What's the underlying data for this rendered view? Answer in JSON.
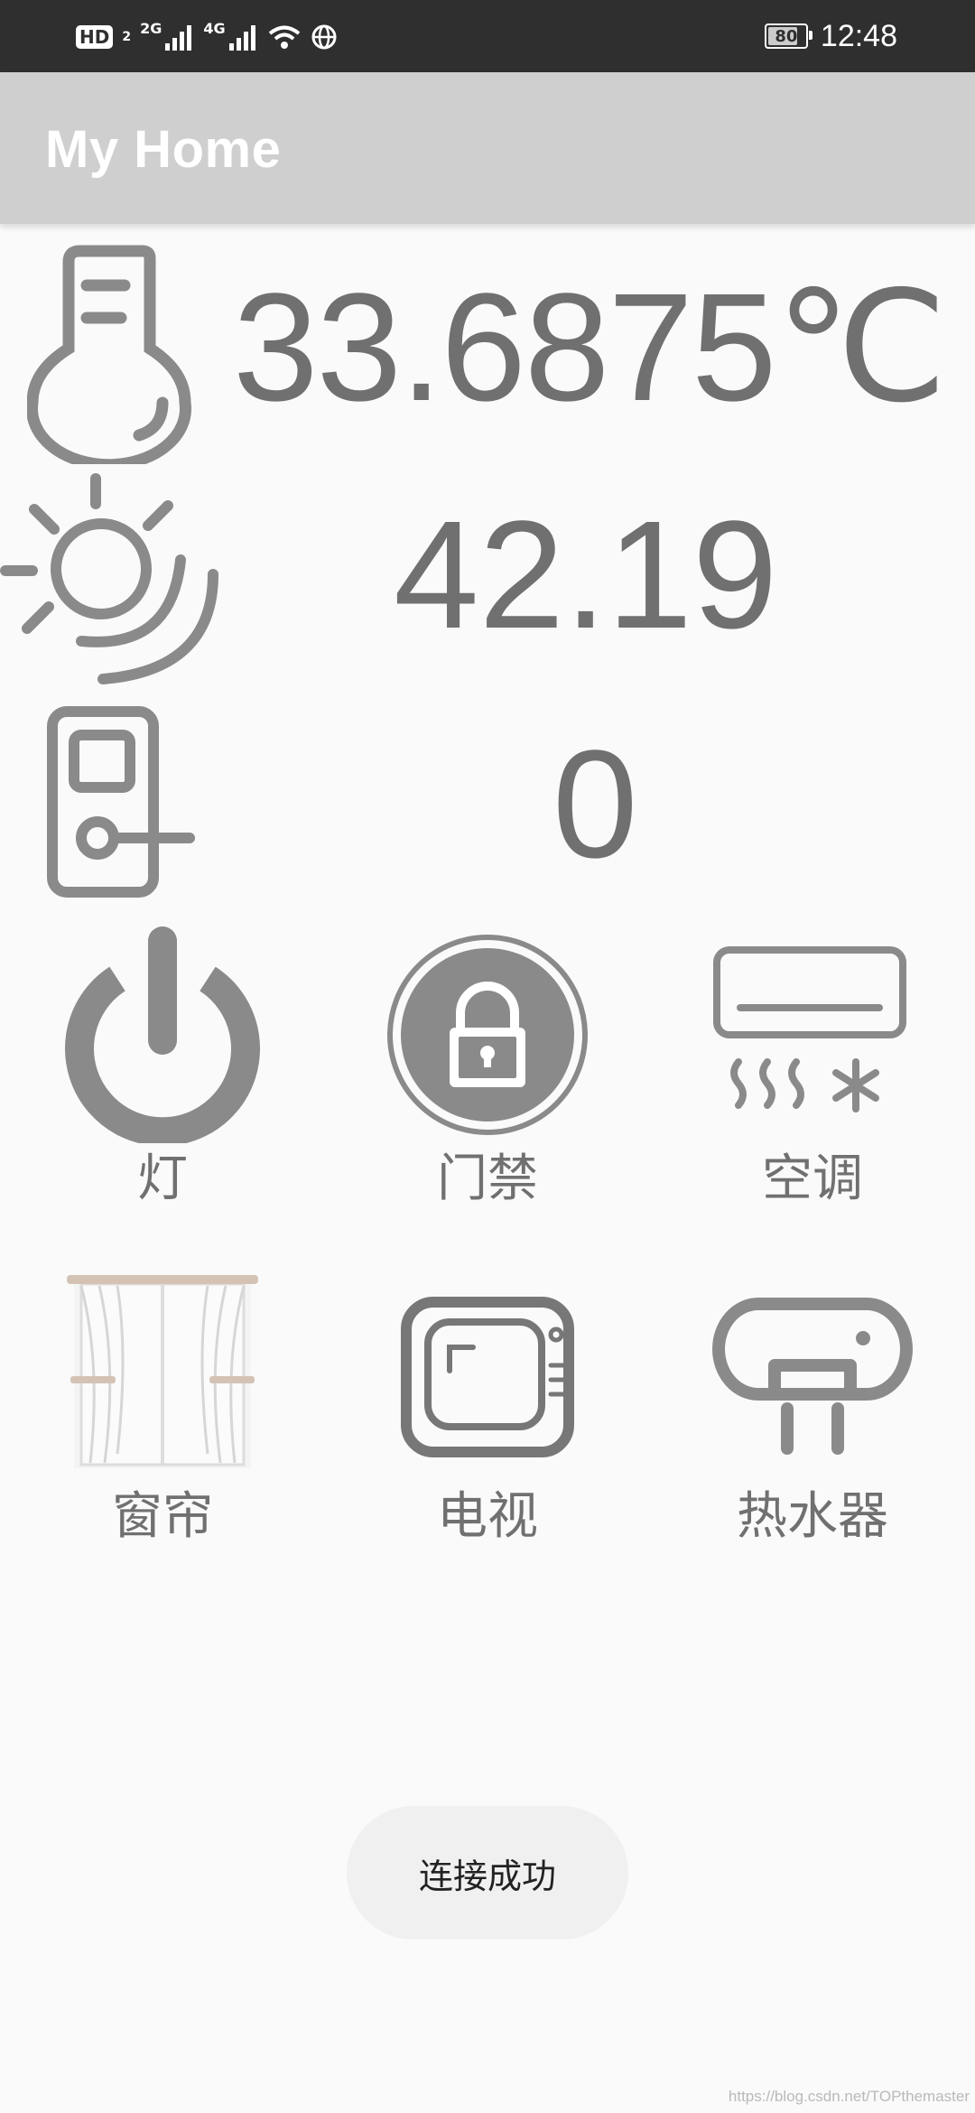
{
  "status_bar": {
    "hd_label": "HD",
    "sim1_label": "2",
    "net1_label": "2G",
    "net2_label": "4G",
    "battery_level": "80",
    "time": "12:48"
  },
  "app_bar": {
    "title": "My Home"
  },
  "sensors": {
    "temperature": "33.6875℃",
    "light": "42.19",
    "door": "0"
  },
  "devices": [
    {
      "label": "灯",
      "icon": "power-icon"
    },
    {
      "label": "门禁",
      "icon": "lock-icon"
    },
    {
      "label": "空调",
      "icon": "air-conditioner-icon"
    },
    {
      "label": "窗帘",
      "icon": "curtain-icon"
    },
    {
      "label": "电视",
      "icon": "tv-icon"
    },
    {
      "label": "热水器",
      "icon": "water-heater-icon"
    }
  ],
  "toast": {
    "message": "连接成功"
  },
  "watermark": "https://blog.csdn.net/TOPthemaster",
  "colors": {
    "icon_gray": "#8a8a8a",
    "value_gray": "#707070",
    "app_bar": "#cfcfcf",
    "status_bar": "#2f2f2f"
  }
}
